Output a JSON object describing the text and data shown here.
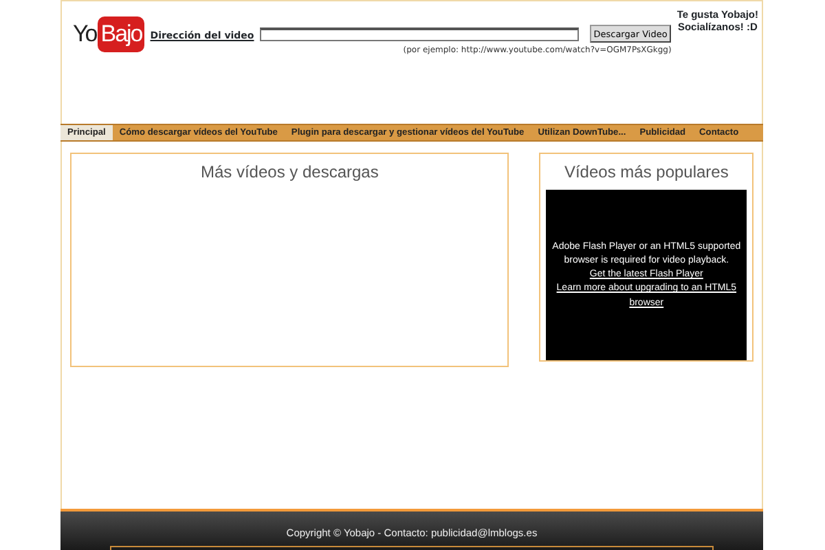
{
  "header": {
    "logo": {
      "part_1": "Yo",
      "part_2": "Bajo"
    },
    "url_label": "Dirección del video",
    "submit_button": "Descargar Video",
    "example": "(por ejemplo: http://www.youtube.com/watch?v=OGM7PsXGkgg)",
    "social": [
      "Te gusta Yobajo!",
      "Socialízanos! :D"
    ]
  },
  "nav": [
    {
      "label": "Principal",
      "selected": true
    },
    {
      "label": "Cómo descargar vídeos del YouTube",
      "selected": false
    },
    {
      "label": "Plugin para descargar y gestionar vídeos del YouTube",
      "selected": false
    },
    {
      "label": "Utilizan DownTube...",
      "selected": false
    },
    {
      "label": "Publicidad",
      "selected": false
    },
    {
      "label": "Contacto",
      "selected": false
    }
  ],
  "main_panel": {
    "title": "Más vídeos y descargas"
  },
  "side_panel": {
    "title": "Vídeos más populares",
    "player": {
      "message": "Adobe Flash Player or an HTML5 supported browser is required for video playback.",
      "links": [
        "Get the latest Flash Player",
        "Learn more about upgrading to an HTML5 browser"
      ]
    }
  },
  "footer": "Copyright © Yobajo - Contacto: publicidad@lmblogs.es"
}
